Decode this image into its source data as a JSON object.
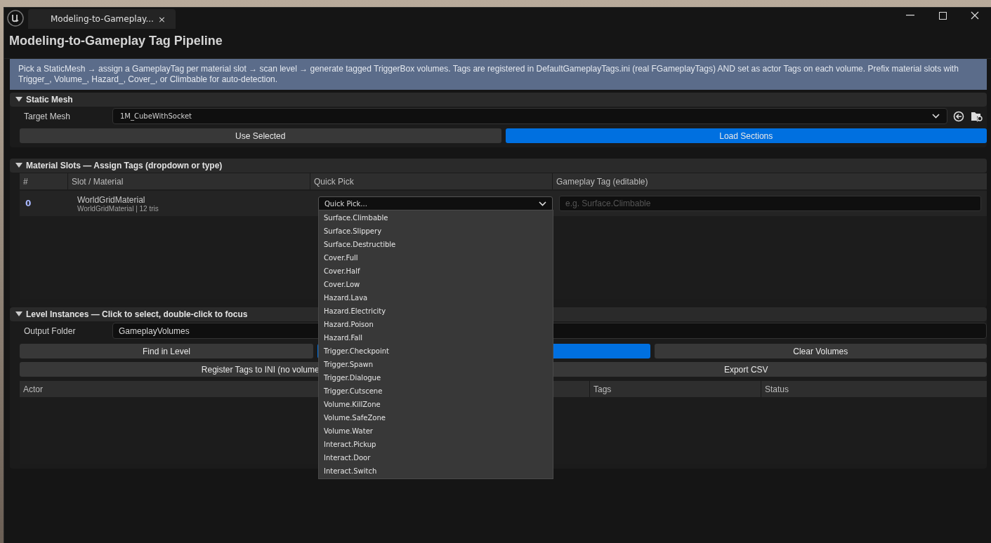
{
  "window": {
    "tab_title": "Modeling-to-Gameplay...",
    "tab_close": "×",
    "title": "Modeling-to-Gameplay Tag Pipeline"
  },
  "info": "Pick a StaticMesh → assign a GameplayTag per material slot → scan level → generate tagged TriggerBox volumes. Tags are registered in DefaultGameplayTags.ini (real FGameplayTags) AND set as actor Tags on each volume. Prefix material slots with Trigger_, Volume_, Hazard_, Cover_, or Climbable for auto-detection.",
  "static_mesh": {
    "header": "Static Mesh",
    "expanded": true,
    "label": "Target Mesh",
    "value": "1M_CubeWithSocket",
    "buttons": [
      {
        "label": "Use Selected",
        "primary": false
      },
      {
        "label": "Load Sections",
        "primary": true
      }
    ]
  },
  "material_slots": {
    "header": "Material Slots — Assign Tags (dropdown or type)",
    "expanded": true,
    "columns": [
      "#",
      "Slot / Material",
      "Quick Pick",
      "Gameplay Tag (editable)"
    ],
    "rows": [
      {
        "index": "0",
        "name": "WorldGridMaterial",
        "detail": "WorldGridMaterial | 12 tris",
        "quick_pick": "Quick Pick...",
        "tag_placeholder": "e.g. Surface.Climbable"
      }
    ]
  },
  "level_instances": {
    "header": "Level Instances — Click to select, double-click to focus",
    "expanded": true,
    "label": "Output Folder",
    "value": "GameplayVolumes",
    "button_rows": [
      [
        {
          "label": "Find in Level",
          "primary": false
        },
        {
          "primary": true
        },
        {
          "label": "Clear Volumes",
          "primary": false
        }
      ],
      [
        {
          "label": "Register Tags to INI (no volume",
          "primary": false
        },
        {
          "label": "Export CSV",
          "primary": false
        }
      ]
    ],
    "columns": [
      "Actor",
      "Tags",
      "Status"
    ]
  },
  "dropdown": {
    "open": true,
    "options": [
      "Surface.Climbable",
      "Surface.Slippery",
      "Surface.Destructible",
      "Cover.Full",
      "Cover.Half",
      "Cover.Low",
      "Hazard.Lava",
      "Hazard.Electricity",
      "Hazard.Poison",
      "Hazard.Fall",
      "Trigger.Checkpoint",
      "Trigger.Spawn",
      "Trigger.Dialogue",
      "Trigger.Cutscene",
      "Volume.KillZone",
      "Volume.SafeZone",
      "Volume.Water",
      "Interact.Pickup",
      "Interact.Door",
      "Interact.Switch"
    ]
  }
}
